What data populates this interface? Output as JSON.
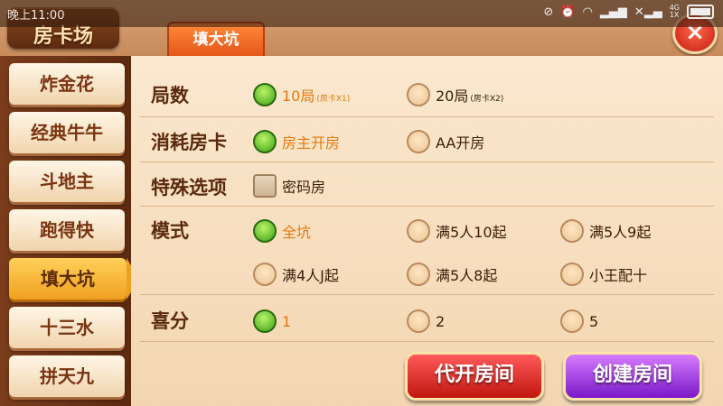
{
  "status_bar": {
    "time": "晚上11:00",
    "icons": [
      "signal-mute-icon",
      "alarm-icon",
      "wifi-icon",
      "signal-icon",
      "signal-icon",
      "data-4g-icon",
      "battery-icon"
    ]
  },
  "header": {
    "title": "房卡场",
    "active_tab": "填大坑",
    "close_glyph": "×"
  },
  "sidebar": {
    "items": [
      {
        "label": "炸金花",
        "active": false
      },
      {
        "label": "经典牛牛",
        "active": false
      },
      {
        "label": "斗地主",
        "active": false
      },
      {
        "label": "跑得快",
        "active": false
      },
      {
        "label": "填大坑",
        "active": true
      },
      {
        "label": "十三水",
        "active": false
      },
      {
        "label": "拼天九",
        "active": false
      }
    ]
  },
  "options": {
    "rounds": {
      "label": "局数",
      "choices": [
        {
          "text": "10局",
          "sub": "(房卡X1)",
          "selected": true
        },
        {
          "text": "20局",
          "sub": "(房卡X2)",
          "selected": false
        }
      ]
    },
    "card_cost": {
      "label": "消耗房卡",
      "choices": [
        {
          "text": "房主开房",
          "selected": true
        },
        {
          "text": "AA开房",
          "selected": false
        }
      ]
    },
    "special": {
      "label": "特殊选项",
      "choices": [
        {
          "text": "密码房",
          "checked": false
        }
      ]
    },
    "mode": {
      "label": "模式",
      "choices": [
        {
          "text": "全坑",
          "selected": true
        },
        {
          "text": "满5人10起",
          "selected": false
        },
        {
          "text": "满5人9起",
          "selected": false
        },
        {
          "text": "满4人J起",
          "selected": false
        },
        {
          "text": "满5人8起",
          "selected": false
        },
        {
          "text": "小王配十",
          "selected": false
        }
      ]
    },
    "bonus": {
      "label": "喜分",
      "choices": [
        {
          "text": "1",
          "selected": true
        },
        {
          "text": "2",
          "selected": false
        },
        {
          "text": "5",
          "selected": false
        }
      ]
    }
  },
  "buttons": {
    "proxy_open": "代开房间",
    "create_room": "创建房间"
  }
}
